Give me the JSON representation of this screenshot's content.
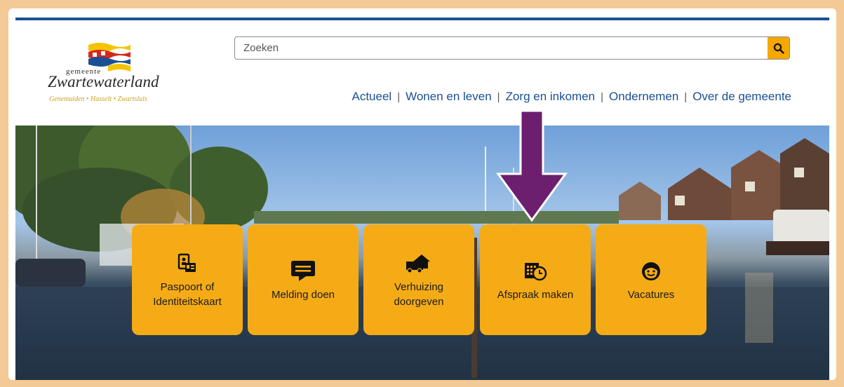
{
  "logo": {
    "small": "gemeente",
    "name": "Zwartewaterland",
    "places": "Genemuiden • Hasselt • Zwartsluis"
  },
  "search": {
    "placeholder": "Zoeken",
    "icon": "search-icon"
  },
  "nav": {
    "items": [
      {
        "label": "Actueel"
      },
      {
        "label": "Wonen en leven"
      },
      {
        "label": "Zorg en inkomen"
      },
      {
        "label": "Ondernemen"
      },
      {
        "label": "Over de gemeente"
      }
    ]
  },
  "tiles": [
    {
      "line1": "Paspoort of",
      "line2": "Identiteitskaart",
      "icon": "id-card-icon"
    },
    {
      "line1": "Melding doen",
      "line2": "",
      "icon": "chat-icon"
    },
    {
      "line1": "Verhuizing",
      "line2": "doorgeven",
      "icon": "moving-truck-icon"
    },
    {
      "line1": "Afspraak maken",
      "line2": "",
      "icon": "calendar-clock-icon"
    },
    {
      "line1": "Vacatures",
      "line2": "",
      "icon": "smiley-icon"
    }
  ],
  "colors": {
    "brand_blue": "#1c4f93",
    "tile_orange": "#f5ab16",
    "arrow_purple": "#6b1f6e",
    "frame": "#f3c995"
  }
}
